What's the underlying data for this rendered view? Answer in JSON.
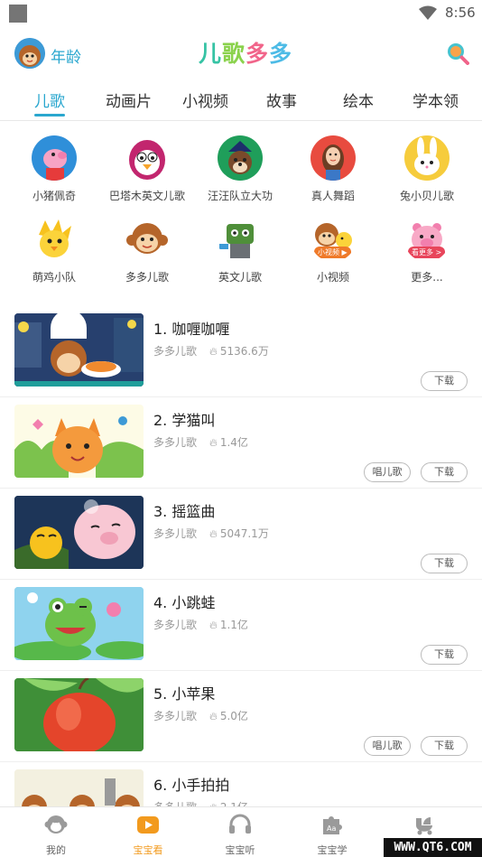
{
  "status_bar": {
    "time": "8:56"
  },
  "header": {
    "age_label": "年龄",
    "logo_chars": [
      "儿",
      "歌",
      "多",
      "多"
    ]
  },
  "tabs": [
    {
      "label": "儿歌",
      "active": true
    },
    {
      "label": "动画片"
    },
    {
      "label": "小视频"
    },
    {
      "label": "故事"
    },
    {
      "label": "绘本"
    },
    {
      "label": "学本领"
    }
  ],
  "categories": [
    {
      "label": "小猪佩奇",
      "icon": "pig-icon"
    },
    {
      "label": "巴塔木英文儿歌",
      "icon": "penguin-icon"
    },
    {
      "label": "汪汪队立大功",
      "icon": "dog-icon"
    },
    {
      "label": "真人舞蹈",
      "icon": "girl-icon"
    },
    {
      "label": "兔小贝儿歌",
      "icon": "rabbit-icon"
    },
    {
      "label": "萌鸡小队",
      "icon": "chick-icon"
    },
    {
      "label": "多多儿歌",
      "icon": "monkey-icon"
    },
    {
      "label": "英文儿歌",
      "icon": "robot-icon"
    },
    {
      "label": "小视频",
      "icon": "monkey-chick-icon",
      "tag": "小视频 ▶"
    },
    {
      "label": "更多...",
      "icon": "pig-more-icon",
      "tag": "看更多 >"
    }
  ],
  "list": [
    {
      "title": "1. 咖喱咖喱",
      "source": "多多儿歌",
      "plays": "5136.6万",
      "buttons": [
        "下载"
      ]
    },
    {
      "title": "2. 学猫叫",
      "source": "多多儿歌",
      "plays": "1.4亿",
      "buttons": [
        "唱儿歌",
        "下载"
      ]
    },
    {
      "title": "3. 摇篮曲",
      "source": "多多儿歌",
      "plays": "5047.1万",
      "buttons": [
        "下载"
      ]
    },
    {
      "title": "4. 小跳蛙",
      "source": "多多儿歌",
      "plays": "1.1亿",
      "buttons": [
        "下载"
      ]
    },
    {
      "title": "5. 小苹果",
      "source": "多多儿歌",
      "plays": "5.0亿",
      "buttons": [
        "唱儿歌",
        "下载"
      ]
    },
    {
      "title": "6. 小手拍拍",
      "source": "多多儿歌",
      "plays": "2.1亿",
      "buttons": []
    }
  ],
  "bottom_nav": [
    {
      "label": "我的",
      "icon": "monkey-face-icon"
    },
    {
      "label": "宝宝看",
      "icon": "play-tv-icon",
      "active": true
    },
    {
      "label": "宝宝听",
      "icon": "headphones-icon"
    },
    {
      "label": "宝宝学",
      "icon": "puzzle-icon"
    },
    {
      "label": "",
      "icon": "stroller-icon"
    }
  ],
  "watermark": "WWW.QT6.COM",
  "colors": {
    "accent": "#2aa7cf",
    "active_nav": "#f29a1e"
  }
}
